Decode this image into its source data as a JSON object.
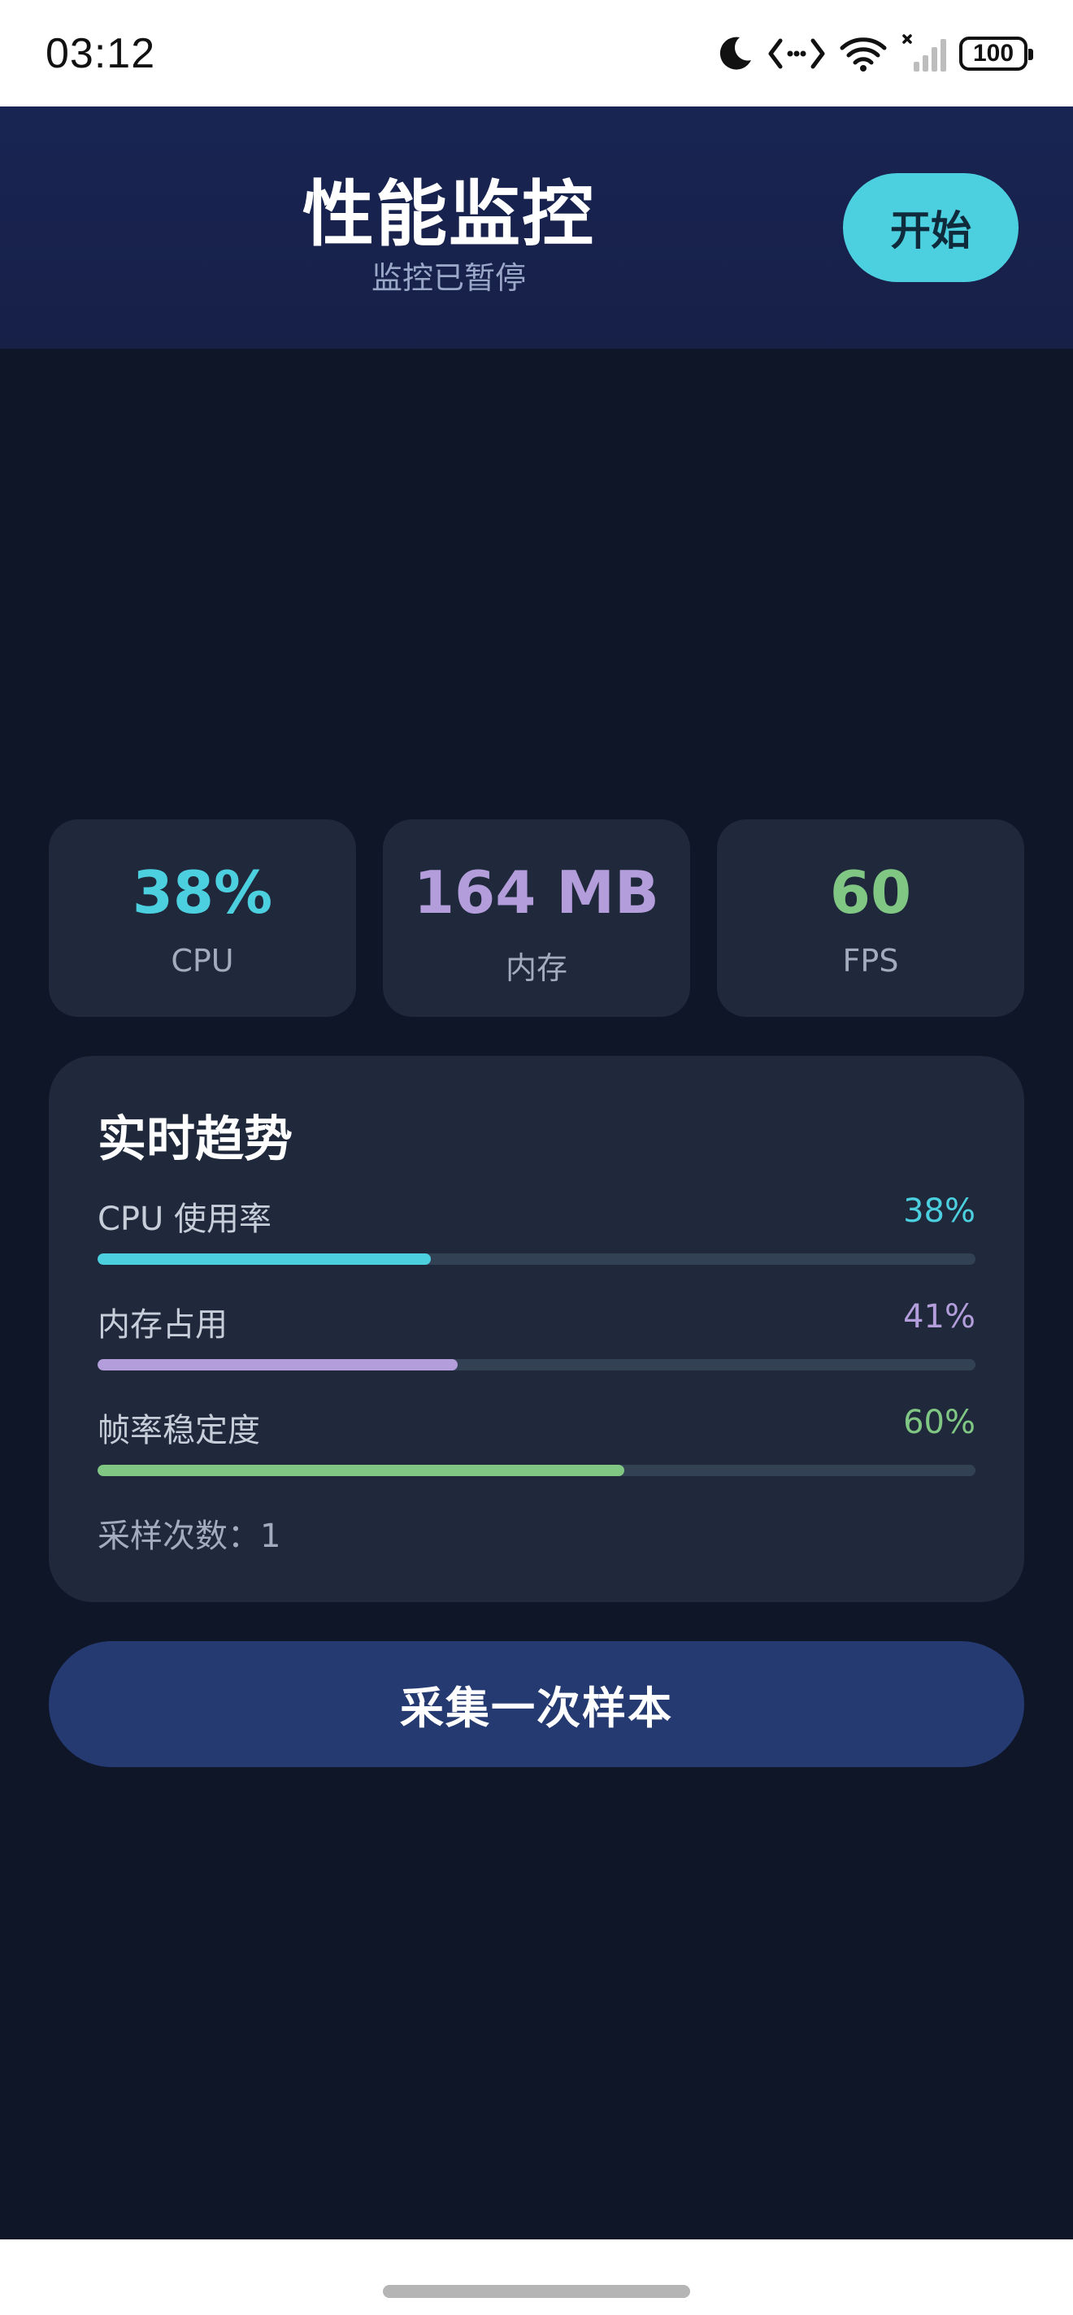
{
  "status_bar": {
    "time": "03:12",
    "battery": "100",
    "icons": [
      "moon-icon",
      "data-transfer-icon",
      "wifi-icon",
      "cellular-signal-icon",
      "battery-icon"
    ]
  },
  "header": {
    "title": "性能监控",
    "subtitle": "监控已暂停",
    "start_button_label": "开始"
  },
  "stats": {
    "cpu": {
      "value": "38%",
      "label": "CPU",
      "color": "#4cd0e0"
    },
    "memory": {
      "value": "164 MB",
      "label": "内存",
      "color": "#b39ddb"
    },
    "fps": {
      "value": "60",
      "label": "FPS",
      "color": "#81c784"
    }
  },
  "trend": {
    "title": "实时趋势",
    "metrics": [
      {
        "label": "CPU 使用率",
        "value_text": "38%",
        "fraction": 0.38,
        "color": "#4cd0e0"
      },
      {
        "label": "内存占用",
        "value_text": "41%",
        "fraction": 0.41,
        "color": "#b39ddb"
      },
      {
        "label": "帧率稳定度",
        "value_text": "60%",
        "fraction": 0.6,
        "color": "#81c784"
      }
    ],
    "sample_count_text": "采样次数：1"
  },
  "actions": {
    "sample_button_label": "采集一次样本"
  }
}
